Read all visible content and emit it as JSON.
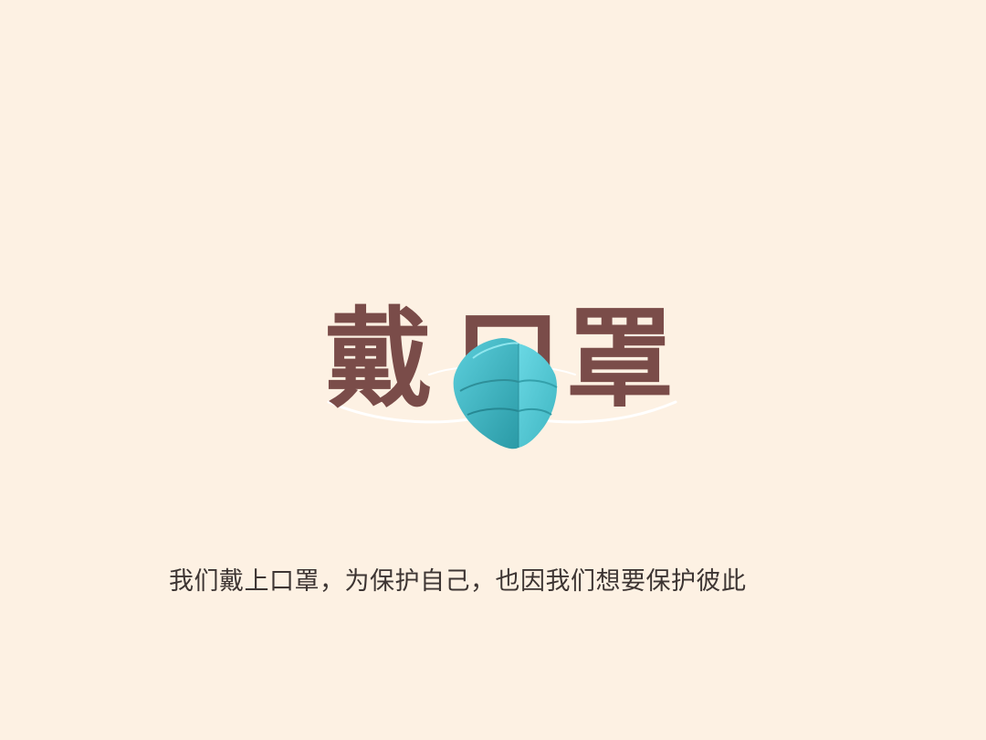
{
  "title": {
    "char_1": "戴",
    "char_2": "口",
    "char_3": "罩"
  },
  "subtitle": "我们戴上口罩，为保护自己，也因我们想要保护彼此",
  "icons": {
    "mask": "face-mask-icon"
  },
  "colors": {
    "background": "#fdf1e3",
    "title": "#7a4c49",
    "mask_light": "#5ccfdc",
    "mask_dark": "#2a9aa6",
    "subtitle": "#3d3533"
  }
}
